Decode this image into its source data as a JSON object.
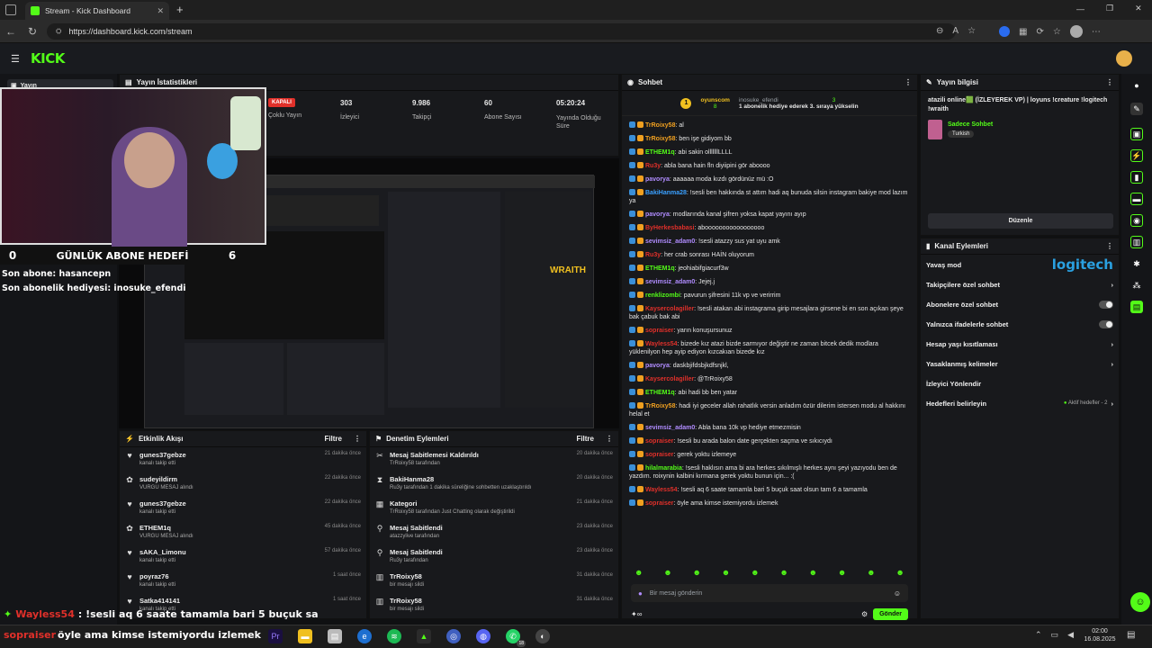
{
  "browser": {
    "tab_title": "Stream - Kick Dashboard",
    "new_tab": "+",
    "url": "https://dashboard.kick.com/stream",
    "window_controls": [
      "—",
      "❐",
      "✕"
    ]
  },
  "app": {
    "logo": "KICK",
    "sidebar_item": "Yayın"
  },
  "stats": {
    "title": "Yayın İstatistikleri",
    "status_badge": "KAPALI",
    "status_label": "Çoklu Yayın",
    "items": [
      {
        "value": "303",
        "label": "İzleyici"
      },
      {
        "value": "9.986",
        "label": "Takipçi"
      },
      {
        "value": "60",
        "label": "Abone Sayısı"
      },
      {
        "value": "05:20:24",
        "label": "Yayında Olduğu Süre"
      }
    ]
  },
  "overlay": {
    "goal_left": "0",
    "goal_title": "GÜNLÜK ABONE HEDEFİ",
    "goal_right": "6",
    "last_sub": "Son abone: hasancepn",
    "last_gift": "Son abonelik hediyesi: inosuke_efendi",
    "bottom_user": "Wayless54",
    "bottom_msg": ": !sesli aq 6 saate tamamla bari 5 buçuk sa",
    "ticker_user": "sopraiser",
    "ticker_msg": " öyle ama kimse istemiyordu izlemek"
  },
  "activity": {
    "title": "Etkinlik Akışı",
    "filter": "Filtre",
    "items": [
      {
        "icon": "heart",
        "name": "gunes37gebze",
        "sub": "kanalı takip etti",
        "time": "21 dakika önce"
      },
      {
        "icon": "gift",
        "name": "sudeyildirm",
        "sub": "VURGU MESAJ alındı",
        "time": "22 dakika önce"
      },
      {
        "icon": "heart",
        "name": "gunes37gebze",
        "sub": "kanalı takip etti",
        "time": "22 dakika önce"
      },
      {
        "icon": "gift",
        "name": "ETHEM1q",
        "sub": "VURGU MESAJ alındı",
        "time": "45 dakika önce"
      },
      {
        "icon": "heart",
        "name": "sAKA_Limonu",
        "sub": "kanalı takip etti",
        "time": "57 dakika önce"
      },
      {
        "icon": "heart",
        "name": "poyraz76",
        "sub": "kanalı takip etti",
        "time": "1 saat önce"
      },
      {
        "icon": "heart",
        "name": "Satka414141",
        "sub": "kanalı takip etti",
        "time": "1 saat önce"
      }
    ]
  },
  "moderation": {
    "title": "Denetim Eylemleri",
    "filter": "Filtre",
    "items": [
      {
        "icon": "unpin",
        "name": "Mesaj Sabitlemesi Kaldırıldı",
        "sub": "TrRoixy58 tarafından",
        "time": "20 dakika önce"
      },
      {
        "icon": "timeout",
        "name": "BakiHanma28",
        "sub": "Ru3y tarafından 1 dakika süreliğine sohbetten uzaklaştırıldı",
        "time": "20 dakika önce"
      },
      {
        "icon": "category",
        "name": "Kategori",
        "sub": "TrRoixy58 tarafından Just Chatting olarak değiştirildi",
        "time": "21 dakika önce"
      },
      {
        "icon": "pin",
        "name": "Mesaj Sabitlendi",
        "sub": "atazzylive tarafından",
        "time": "23 dakika önce"
      },
      {
        "icon": "pin",
        "name": "Mesaj Sabitlendi",
        "sub": "Ru3y tarafından",
        "time": "23 dakika önce"
      },
      {
        "icon": "trash",
        "name": "TrRoixy58",
        "sub": "bir mesajı sildi",
        "time": "31 dakika önce"
      },
      {
        "icon": "trash",
        "name": "TrRoixy58",
        "sub": "bir mesajı sildi",
        "time": "31 dakika önce"
      }
    ]
  },
  "chat": {
    "title": "Sohbet",
    "top_gifter": "oyunscom",
    "top_gifter_count": "8",
    "gifter2": "inosuke_efendi",
    "gifter2_count": "3",
    "gift_line": "1 abonelik hediye ederek 3. sıraya yükselin",
    "messages": [
      {
        "user": "TrRoixy58",
        "color": "#f0a020",
        "text": ": al"
      },
      {
        "user": "TrRoixy58",
        "color": "#f0a020",
        "text": ": ben işe gidiyom bb"
      },
      {
        "user": "ETHEM1q",
        "color": "#53fc18",
        "text": ": abi sakin olllllllLLLL"
      },
      {
        "user": "Ru3y",
        "color": "#e0302a",
        "text": ": abla bana hain fln diyiipini gör aboooo"
      },
      {
        "user": "pavorya",
        "color": "#b08cff",
        "text": ": aaaaaa moda kızdı gördünüz mü :O"
      },
      {
        "user": "BakiHanma28",
        "color": "#3aa0ff",
        "text": ": !sesli ben hakkında st attım hadi aq bunuda silsin instagram bakiye mod lazım ya"
      },
      {
        "user": "pavorya",
        "color": "#b08cff",
        "text": ": modlarında kanal şifren yoksa kapat yayını ayıp"
      },
      {
        "user": "ByHerkesbabasi",
        "color": "#e0302a",
        "text": ": abooooooooooooooooo"
      },
      {
        "user": "sevimsiz_adam0",
        "color": "#b08cff",
        "text": ": !sesli atazzy sus yat uyu amk"
      },
      {
        "user": "Ru3y",
        "color": "#e0302a",
        "text": ": her crab sonrası HAİN oluyorum"
      },
      {
        "user": "ETHEM1q",
        "color": "#53fc18",
        "text": ": jeohiabifgiacurf3w"
      },
      {
        "user": "sevimsiz_adam0",
        "color": "#b08cff",
        "text": ": Jejej.j"
      },
      {
        "user": "renklizombi",
        "color": "#53fc18",
        "text": ": pavurun şifresini 11k vp ve verirrim"
      },
      {
        "user": "Kaysercolagiller",
        "color": "#e0302a",
        "text": ": !sesli atakan abi instagrama girip mesajlara girsene bi en son açıkan şeye bak çabuk bak abi"
      },
      {
        "user": "sopraiser",
        "color": "#e0302a",
        "text": ": yarın konuşursunuz"
      },
      {
        "user": "Wayless54",
        "color": "#e0302a",
        "text": ": bizede kız atazi bizde sarmıyor değiştir ne zaman bitcek dedik modlara yüklenilyon hep ayip ediyon kızcakıan bizede kız"
      },
      {
        "user": "pavorya",
        "color": "#b08cff",
        "text": ": daskbjifdsbjkdfsnjkl,"
      },
      {
        "user": "Kaysercolagiller",
        "color": "#e0302a",
        "text": ": @TrRoixy58"
      },
      {
        "user": "ETHEM1q",
        "color": "#53fc18",
        "text": ": abi hadi bb ben yatar"
      },
      {
        "user": "TrRoixy58",
        "color": "#f0a020",
        "text": ": hadi iyi geceler allah rahatlık versin anladım özür dilerim istersen modu al hakkını helal et"
      },
      {
        "user": "sevimsiz_adam0",
        "color": "#b08cff",
        "text": ": Abla bana 10k vp hediye etmezmisin"
      },
      {
        "user": "sopraiser",
        "color": "#e0302a",
        "text": ": !sesli bu arada balon date gerçekten saçma ve sıkıcıydı"
      },
      {
        "user": "sopraiser",
        "color": "#e0302a",
        "text": ": gerek yoktu izlemeye"
      },
      {
        "user": "hilalmarabia",
        "color": "#53fc18",
        "text": ": !sesli haklısın ama bi ara herkes sıkılmışlı herkes aynı şeyi yazıyodu ben de yazdım. roixynin kalbini kırmana gerek yoktu bunun için... :("
      },
      {
        "user": "Wayless54",
        "color": "#e0302a",
        "text": ": !sesli aq 6 saate tamamla bari 5 buçuk saat olsun tam 6 a tamamla"
      },
      {
        "user": "sopraiser",
        "color": "#e0302a",
        "text": ": öyle ama kimse istemiyordu izlemek"
      }
    ],
    "input_placeholder": "Bir mesaj gönderin",
    "send": "Gönder"
  },
  "stream_info": {
    "title": "Yayın bilgisi",
    "stream_title": "atazili online🟩 (İZLEYEREK VP) | loyuns !creature !logitech !wraith",
    "category": "Sadece Sohbet",
    "tag": "Turkish",
    "edit": "Düzenle"
  },
  "channel_actions": {
    "title": "Kanal Eylemleri",
    "items": [
      {
        "label": "Yavaş mod",
        "control": "none"
      },
      {
        "label": "Takipçilere özel sohbet",
        "control": "arrow"
      },
      {
        "label": "Abonelere özel sohbet",
        "control": "toggle"
      },
      {
        "label": "Yalnızca ifadelerle sohbet",
        "control": "toggle"
      },
      {
        "label": "Hesap yaşı kısıtlaması",
        "control": "arrow"
      },
      {
        "label": "Yasaklanmış kelimeler",
        "control": "arrow"
      },
      {
        "label": "İzleyici Yönlendir",
        "control": "none"
      },
      {
        "label": "Hedefleri belirleyin",
        "control": "arrow",
        "extra": "Aktif hedefler - 2"
      }
    ],
    "logo_text": "logitech"
  },
  "taskbar": {
    "time": "02:00",
    "date": "16.08.2025",
    "badge": "18"
  },
  "colors": {
    "accent": "#53fc18",
    "panel": "#18191c",
    "bg": "#0f1012"
  }
}
